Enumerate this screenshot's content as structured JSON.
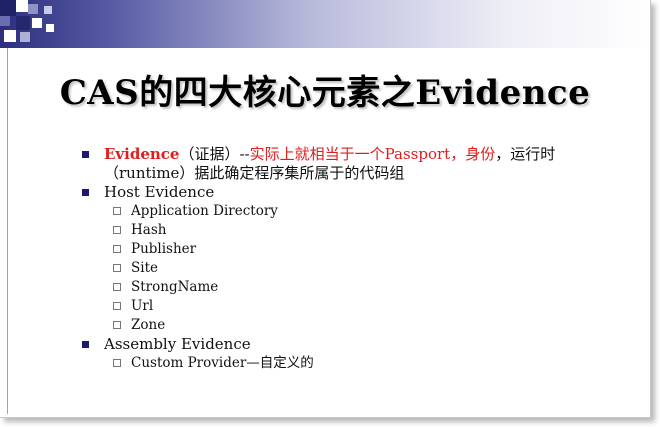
{
  "slide": {
    "title": "CAS的四大核心元素之Evidence",
    "items": [
      {
        "term": "Evidence",
        "paren": "（证据）",
        "dashes": "--",
        "highlight": "实际上就相当于一个Passport，身份",
        "rest": "，运行时",
        "line2": "（runtime）据此确定程序集所属于的代码组"
      },
      {
        "label": "Host Evidence",
        "children": [
          "Application Directory",
          "Hash",
          "Publisher",
          "Site",
          "StrongName",
          "Url",
          "Zone"
        ]
      },
      {
        "label": "Assembly Evidence",
        "children": [
          "Custom Provider—自定义的"
        ]
      }
    ]
  },
  "colors": {
    "accent_red": "#e21b1b",
    "bullet_navy": "#1a1a70",
    "header_dark": "#2b2f7e"
  }
}
